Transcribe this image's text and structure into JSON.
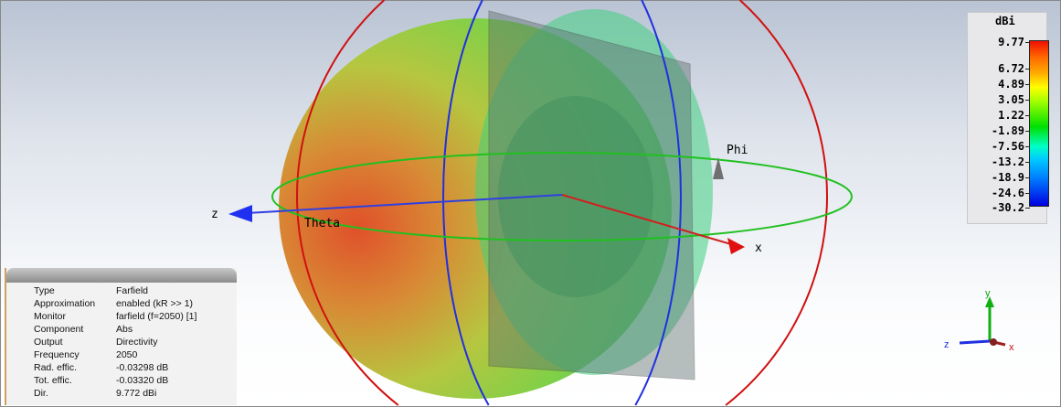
{
  "legend": {
    "unit": "dBi",
    "ticks": [
      "9.77",
      "6.72",
      "4.89",
      "3.05",
      "1.22",
      "-1.89",
      "-7.56",
      "-13.2",
      "-18.9",
      "-24.6",
      "-30.2"
    ]
  },
  "axes": {
    "z": "z",
    "x": "x",
    "theta": "Theta",
    "phi": "Phi"
  },
  "triad": {
    "x": "x",
    "y": "y",
    "z": "z"
  },
  "info": [
    {
      "label": "Type",
      "value": "Farfield"
    },
    {
      "label": "Approximation",
      "value": "enabled (kR >> 1)"
    },
    {
      "label": "Monitor",
      "value": "farfield (f=2050) [1]"
    },
    {
      "label": "Component",
      "value": "Abs"
    },
    {
      "label": "Output",
      "value": "Directivity"
    },
    {
      "label": "Frequency",
      "value": "2050"
    },
    {
      "label": "Rad. effic.",
      "value": "-0.03298 dB"
    },
    {
      "label": "Tot. effic.",
      "value": "-0.03320 dB"
    },
    {
      "label": "Dir.",
      "value": "9.772 dBi"
    }
  ]
}
